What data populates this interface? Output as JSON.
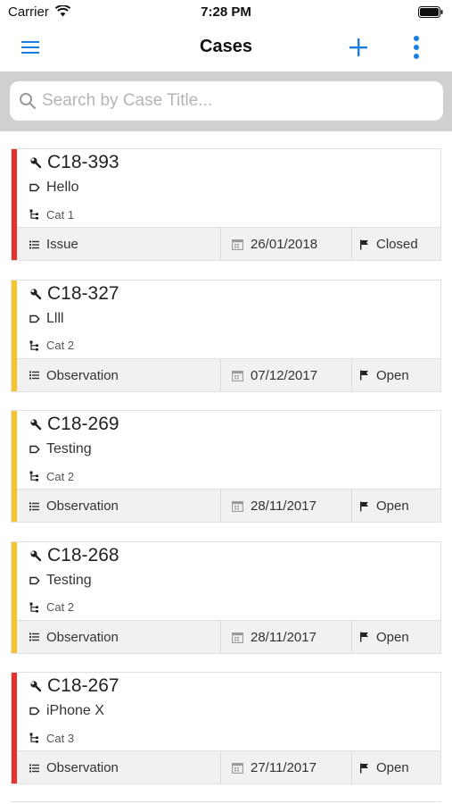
{
  "status_bar": {
    "carrier": "Carrier",
    "time": "7:28 PM"
  },
  "nav": {
    "title": "Cases",
    "menu_icon": "hamburger-menu-icon",
    "add_icon": "plus-icon",
    "more_icon": "vertical-dots-icon",
    "accent_color": "#1a7fe0"
  },
  "search": {
    "placeholder": "Search by Case Title...",
    "value": ""
  },
  "colors": {
    "priority_red": "#e8312c",
    "priority_yellow": "#f6c330"
  },
  "cases": [
    {
      "id": "C18-393",
      "title": "Hello",
      "category": "Cat 1",
      "type": "Issue",
      "date": "26/01/2018",
      "status": "Closed",
      "priority_color": "#e8312c"
    },
    {
      "id": "C18-327",
      "title": "Llll",
      "category": "Cat 2",
      "type": "Observation",
      "date": "07/12/2017",
      "status": "Open",
      "priority_color": "#f6c330"
    },
    {
      "id": "C18-269",
      "title": "Testing",
      "category": "Cat 2",
      "type": "Observation",
      "date": "28/11/2017",
      "status": "Open",
      "priority_color": "#f6c330"
    },
    {
      "id": "C18-268",
      "title": "Testing",
      "category": "Cat 2",
      "type": "Observation",
      "date": "28/11/2017",
      "status": "Open",
      "priority_color": "#f6c330"
    },
    {
      "id": "C18-267",
      "title": "iPhone X",
      "category": "Cat 3",
      "type": "Observation",
      "date": "27/11/2017",
      "status": "Open",
      "priority_color": "#e8312c"
    }
  ]
}
